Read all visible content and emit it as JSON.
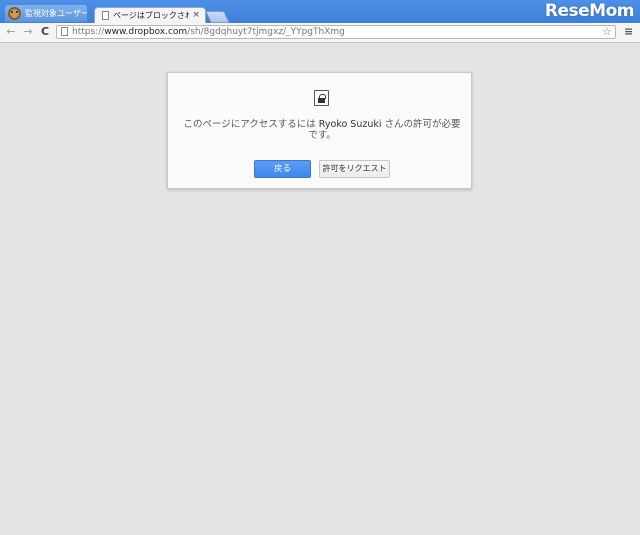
{
  "browser": {
    "profile_label": "監視対象ユーザー",
    "tab": {
      "title": "ページはブロックされてい",
      "close_glyph": "×"
    },
    "watermark": "ReseMom",
    "toolbar": {
      "back_glyph": "←",
      "forward_glyph": "→",
      "reload_glyph": "C",
      "url_scheme": "https://",
      "url_host": "www.dropbox.com",
      "url_path": "/sh/8gdqhuyt7tjmgxz/_YYpgThXmg",
      "star_glyph": "☆",
      "menu_glyph": "≡"
    }
  },
  "dialog": {
    "message_prefix": "このページにアクセスするには ",
    "user_name": "Ryoko Suzuki",
    "message_suffix": " さんの許可が必要です。",
    "back_button": "戻る",
    "request_button": "許可をリクエスト"
  },
  "colors": {
    "tabstrip": "#3f7fd6",
    "page_background": "#e4e4e4",
    "primary_button": "#4287ec"
  }
}
